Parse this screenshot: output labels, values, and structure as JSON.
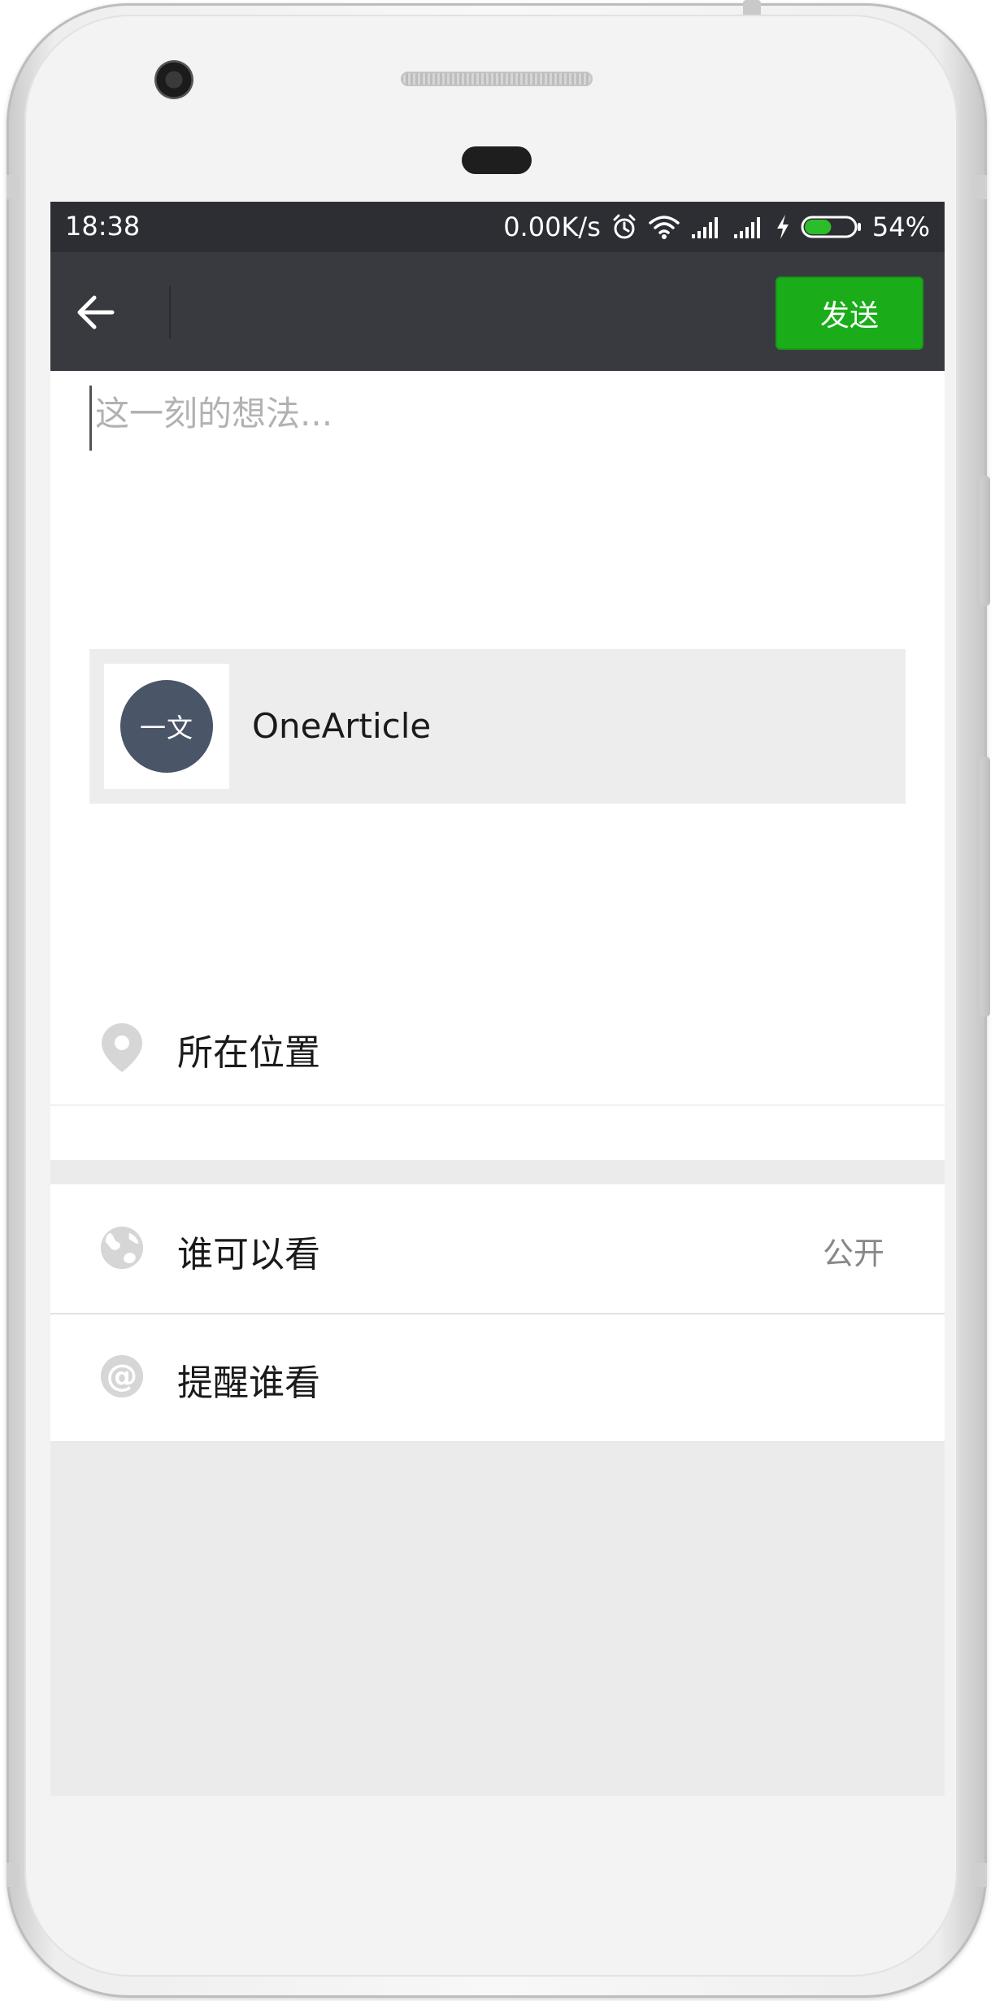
{
  "status_bar": {
    "time": "18:38",
    "network_speed": "0.00K/s",
    "icons": [
      "alarm-icon",
      "wifi-icon",
      "signal-icon",
      "signal-icon",
      "charging-icon",
      "battery-icon"
    ],
    "battery_level": 0.54,
    "battery_percent": "54%"
  },
  "nav": {
    "back_icon": "arrow-left-icon",
    "send_label": "发送",
    "send_color": "#1aad19"
  },
  "compose": {
    "placeholder": "这一刻的想法..."
  },
  "shared_link": {
    "logo_text": "一文",
    "title": "OneArticle"
  },
  "options": {
    "location": {
      "icon": "location-pin-icon",
      "label": "所在位置"
    },
    "visibility": {
      "icon": "globe-icon",
      "label": "谁可以看",
      "value": "公开"
    },
    "mention": {
      "icon": "at-icon",
      "label": "提醒谁看"
    }
  }
}
